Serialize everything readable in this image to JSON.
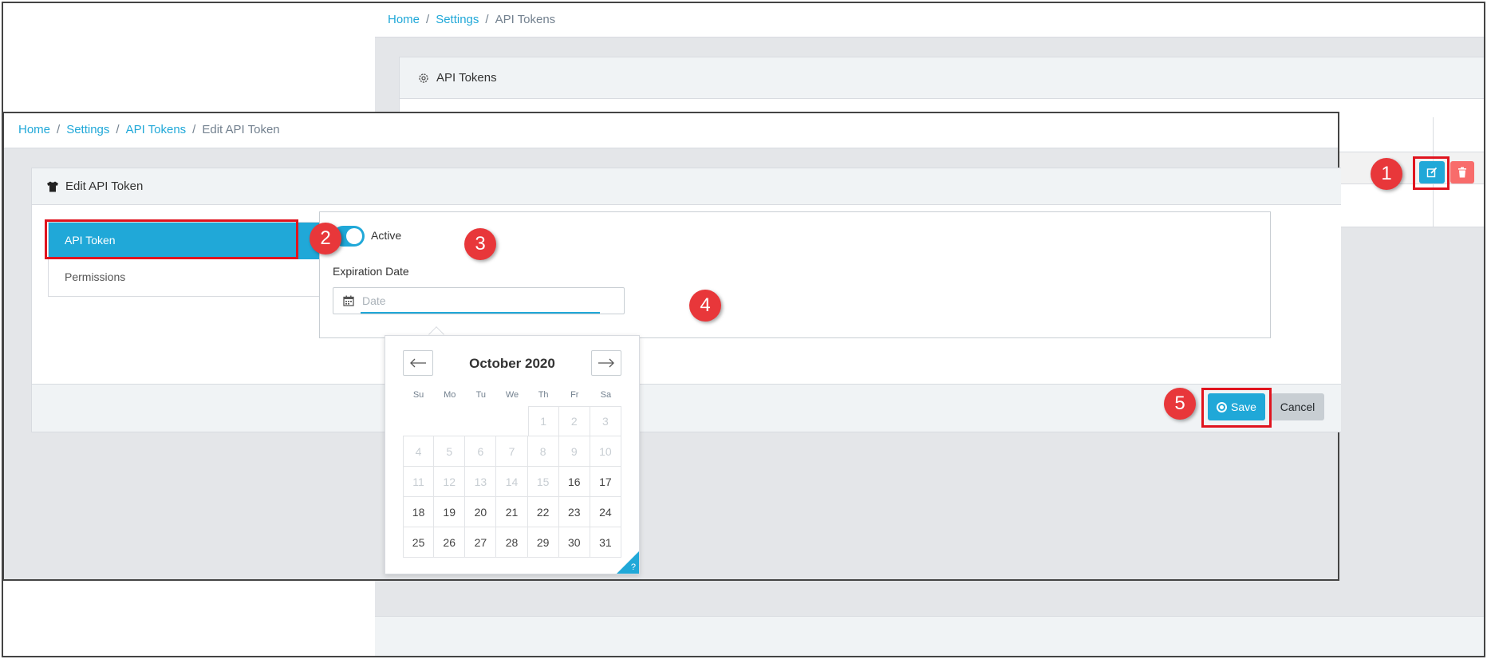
{
  "background_window": {
    "breadcrumb": [
      {
        "label": "Home",
        "link": true
      },
      {
        "label": "Settings",
        "link": true
      },
      {
        "label": "API Tokens",
        "link": false
      }
    ],
    "panel_title": "API Tokens",
    "row_actions": {
      "edit_icon": "edit-icon",
      "delete_icon": "trash-icon"
    }
  },
  "foreground_window": {
    "breadcrumb": [
      {
        "label": "Home",
        "link": true
      },
      {
        "label": "Settings",
        "link": true
      },
      {
        "label": "API Tokens",
        "link": true
      },
      {
        "label": "Edit API Token",
        "link": false
      }
    ],
    "card_title": "Edit API Token",
    "tabs": [
      {
        "label": "API Token",
        "active": true
      },
      {
        "label": "Permissions",
        "active": false
      }
    ],
    "form": {
      "active_toggle": {
        "label": "Active",
        "on": true
      },
      "expiration_label": "Expiration Date",
      "date_placeholder": "Date"
    },
    "actions": {
      "save_label": "Save",
      "cancel_label": "Cancel"
    }
  },
  "calendar": {
    "month_title": "October 2020",
    "prev_icon": "arrow-left-icon",
    "next_icon": "arrow-right-icon",
    "weekdays": [
      "Su",
      "Mo",
      "Tu",
      "We",
      "Th",
      "Fr",
      "Sa"
    ],
    "weeks": [
      [
        null,
        null,
        null,
        null,
        {
          "d": "1",
          "disabled": true
        },
        {
          "d": "2",
          "disabled": true
        },
        {
          "d": "3",
          "disabled": true
        }
      ],
      [
        {
          "d": "4",
          "disabled": true
        },
        {
          "d": "5",
          "disabled": true
        },
        {
          "d": "6",
          "disabled": true
        },
        {
          "d": "7",
          "disabled": true
        },
        {
          "d": "8",
          "disabled": true
        },
        {
          "d": "9",
          "disabled": true
        },
        {
          "d": "10",
          "disabled": true
        }
      ],
      [
        {
          "d": "11",
          "disabled": true
        },
        {
          "d": "12",
          "disabled": true
        },
        {
          "d": "13",
          "disabled": true
        },
        {
          "d": "14",
          "disabled": true
        },
        {
          "d": "15",
          "disabled": true
        },
        {
          "d": "16",
          "disabled": false
        },
        {
          "d": "17",
          "disabled": false
        }
      ],
      [
        {
          "d": "18",
          "disabled": false
        },
        {
          "d": "19",
          "disabled": false
        },
        {
          "d": "20",
          "disabled": false
        },
        {
          "d": "21",
          "disabled": false
        },
        {
          "d": "22",
          "disabled": false
        },
        {
          "d": "23",
          "disabled": false
        },
        {
          "d": "24",
          "disabled": false
        }
      ],
      [
        {
          "d": "25",
          "disabled": false
        },
        {
          "d": "26",
          "disabled": false
        },
        {
          "d": "27",
          "disabled": false
        },
        {
          "d": "28",
          "disabled": false
        },
        {
          "d": "29",
          "disabled": false
        },
        {
          "d": "30",
          "disabled": false
        },
        {
          "d": "31",
          "disabled": false
        }
      ]
    ],
    "help_label": "?"
  },
  "callouts": [
    "1",
    "2",
    "3",
    "4",
    "5"
  ],
  "colors": {
    "primary": "#20a8d8",
    "danger": "#f86c6b",
    "highlight": "#e0141e",
    "callout": "#e8373a"
  }
}
